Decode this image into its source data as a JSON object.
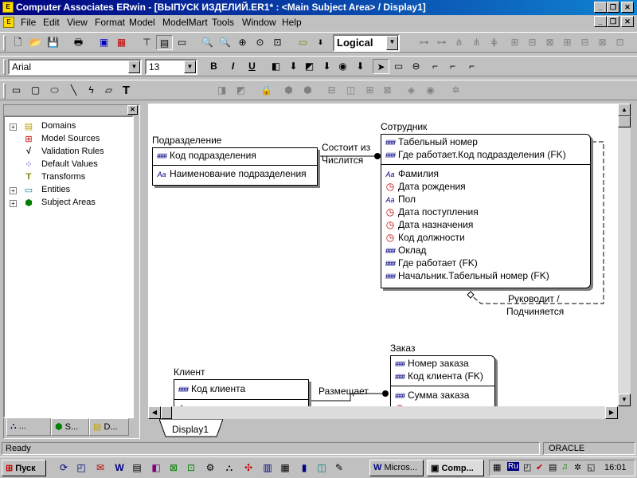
{
  "window": {
    "title": "Computer Associates ERwin - [ВЫПУСК ИЗДЕЛИЙ.ER1* : <Main Subject Area> / Display1]"
  },
  "menu": [
    "File",
    "Edit",
    "View",
    "Format",
    "Model",
    "ModelMart",
    "Tools",
    "Window",
    "Help"
  ],
  "toolbar": {
    "view_level": "Logical",
    "font_name": "Arial",
    "font_size": "13",
    "bold": "B",
    "italic": "I",
    "underline": "U",
    "text_tool": "T"
  },
  "tree": {
    "items": [
      {
        "label": "Domains",
        "icon": "domains-icon",
        "expandable": true
      },
      {
        "label": "Model Sources",
        "icon": "model-sources-icon",
        "expandable": false
      },
      {
        "label": "Validation Rules",
        "icon": "validation-rules-icon",
        "expandable": false
      },
      {
        "label": "Default Values",
        "icon": "default-values-icon",
        "expandable": false
      },
      {
        "label": "Transforms",
        "icon": "transforms-icon",
        "expandable": false
      },
      {
        "label": "Entities",
        "icon": "entities-icon",
        "expandable": true
      },
      {
        "label": "Subject Areas",
        "icon": "subject-areas-icon",
        "expandable": true
      }
    ],
    "tabs": [
      "...",
      "S...",
      "D..."
    ]
  },
  "entities": {
    "podrazdelenie": {
      "name": "Подразделение",
      "keys": [
        "Код подразделения"
      ],
      "attrs": [
        "Наименование подразделения"
      ]
    },
    "sotrudnik": {
      "name": "Сотрудник",
      "keys": [
        "Табельный номер",
        "Где работает.Код подразделения (FK)"
      ],
      "attrs": [
        "Фамилия",
        "Дата рождения",
        "Пол",
        "Дата поступления",
        "Дата назначения",
        "Код должности",
        "Оклад",
        "Где работает (FK)",
        "Начальник.Табельный номер (FK)"
      ]
    },
    "zakaz": {
      "name": "Заказ",
      "keys": [
        "Номер заказа",
        "Код клиента (FK)"
      ],
      "attrs": [
        "Сумма заказа"
      ]
    },
    "klient": {
      "name": "Клиент",
      "keys": [
        "Код клиента"
      ],
      "attrs": []
    }
  },
  "relationships": {
    "r1_top": "Состоит из",
    "r1_bottom": "Числится",
    "r2_top": "Руководит /",
    "r2_bottom": "Подчиняется",
    "r3": "Размещает"
  },
  "canvas_tab": "Display1",
  "status": {
    "text": "Ready",
    "db": "ORACLE"
  },
  "taskbar": {
    "start": "Пуск",
    "tasks": [
      "Micros...",
      "Comp..."
    ],
    "lang": "Ru",
    "clock": "16:01"
  }
}
